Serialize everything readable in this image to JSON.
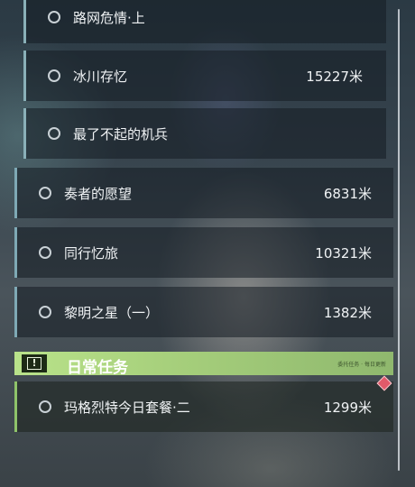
{
  "quests": [
    {
      "name": "路网危情·上",
      "distance": ""
    },
    {
      "name": "冰川存忆",
      "distance": "15227米"
    },
    {
      "name": "最了不起的机兵",
      "distance": ""
    },
    {
      "name": "奏者的愿望",
      "distance": "6831米"
    },
    {
      "name": "同行忆旅",
      "distance": "10321米"
    },
    {
      "name": "黎明之星（一）",
      "distance": "1382米"
    }
  ],
  "daily_section": {
    "title": "日常任务",
    "note": "委托任务 · 每日更新"
  },
  "daily_quests": [
    {
      "name": "玛格烈特今日套餐·二",
      "distance": "1299米"
    }
  ],
  "colors": {
    "accent_green": "#b9e28a",
    "marker_red": "#e15a6a"
  }
}
